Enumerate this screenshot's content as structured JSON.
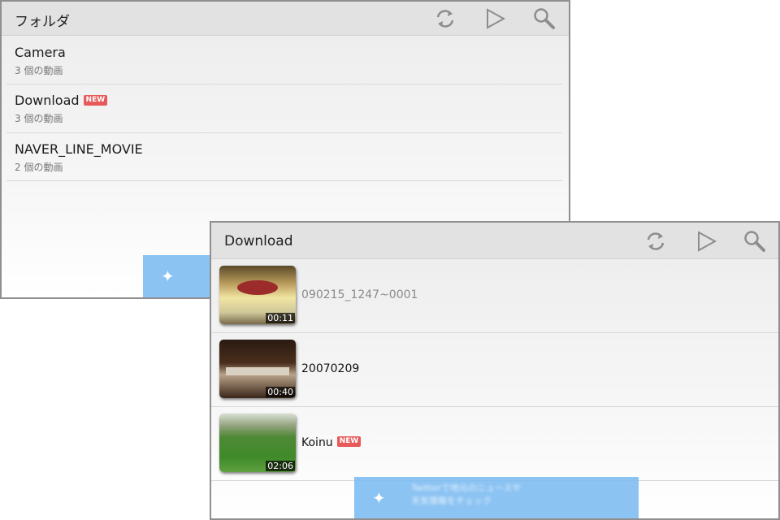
{
  "back_panel": {
    "title": "フォルダ",
    "icons": [
      "refresh-icon",
      "play-icon",
      "search-icon"
    ],
    "folders": [
      {
        "name": "Camera",
        "count": "3 個の動画",
        "new": ""
      },
      {
        "name": "Download",
        "count": "3 個の動画",
        "new": "NEW"
      },
      {
        "name": "NAVER_LINE_MOVIE",
        "count": "2 個の動画",
        "new": ""
      }
    ]
  },
  "front_panel": {
    "title": "Download",
    "icons": [
      "refresh-icon",
      "play-icon",
      "search-icon"
    ],
    "videos": [
      {
        "title": "090215_1247~0001",
        "duration": "00:11",
        "new": ""
      },
      {
        "title": "20070209",
        "duration": "00:40",
        "new": ""
      },
      {
        "title": "Koinu",
        "duration": "02:06",
        "new": "NEW"
      }
    ],
    "banner_text": [
      "Twitterで地元のニュースや",
      "天気情報をチェック"
    ]
  },
  "colors": {
    "header_bg": "#e2e2e2",
    "new_badge": "#e65a5a",
    "banner": "#7fbdf2",
    "panel_border": "#8f8f8f"
  }
}
